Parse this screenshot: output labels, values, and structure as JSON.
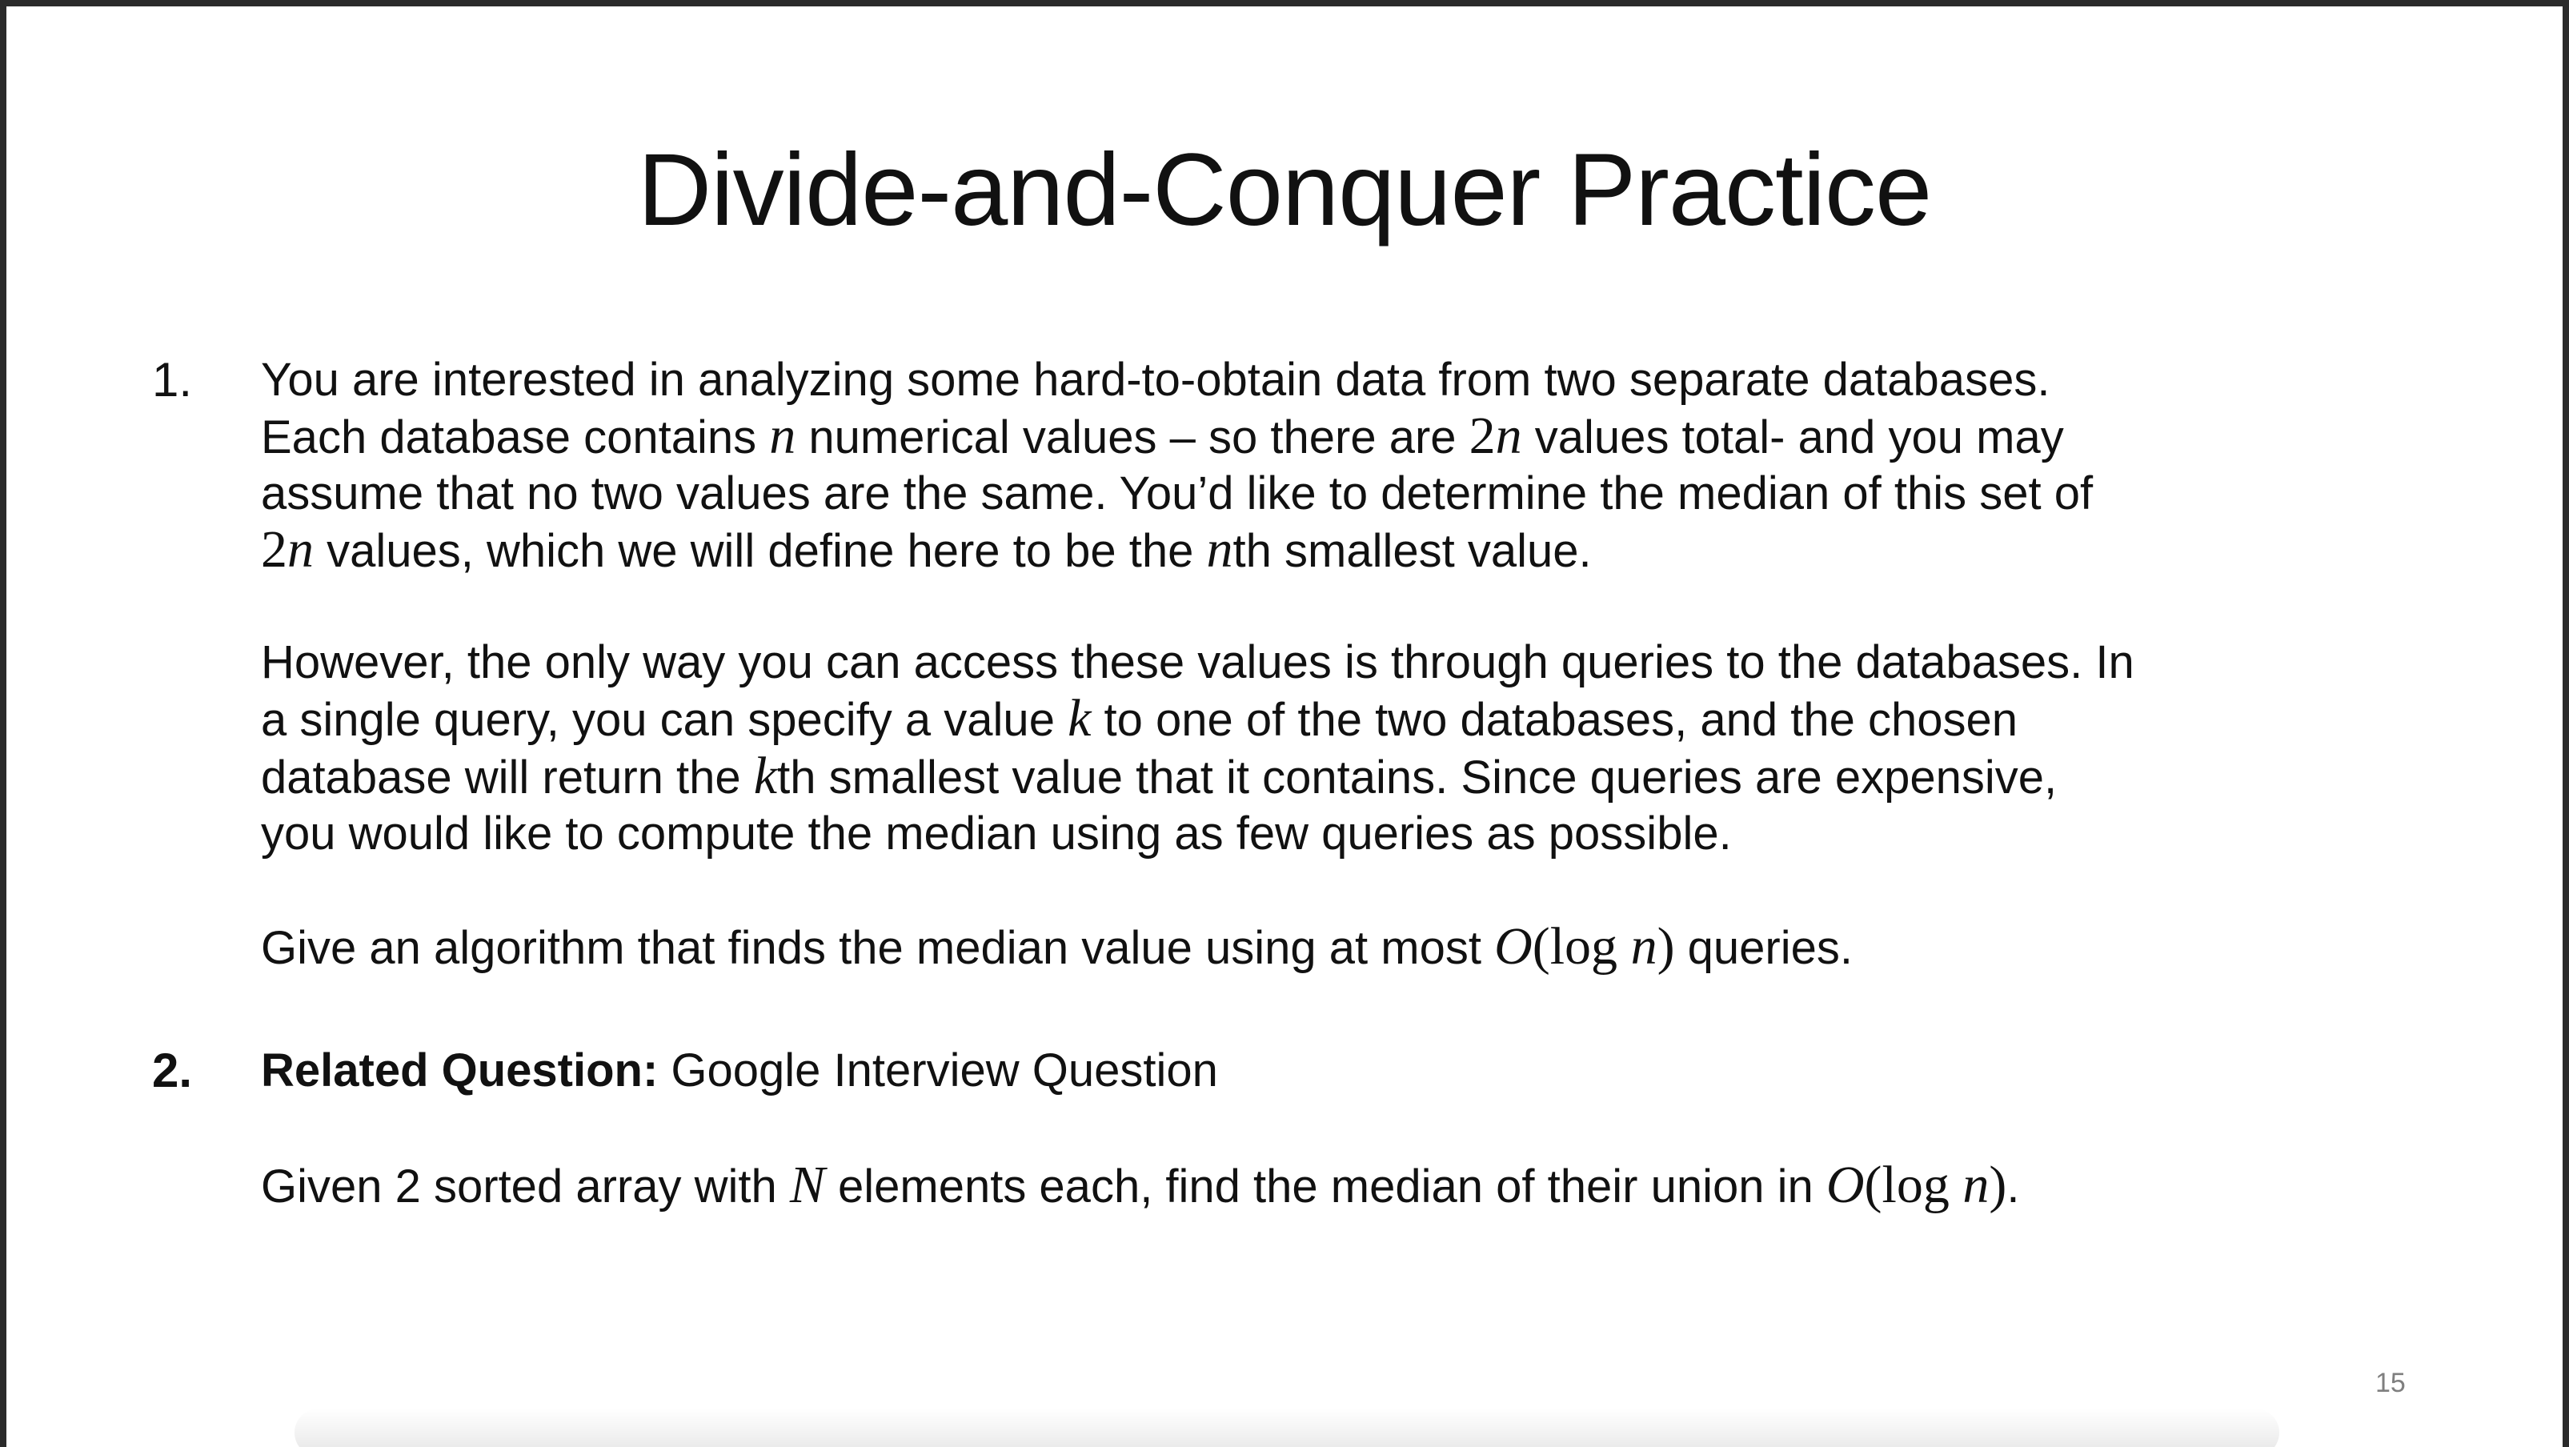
{
  "slide": {
    "title": "Divide-and-Conquer Practice",
    "page_number": "15",
    "item1": {
      "number": "1.",
      "p1": {
        "l1": "You are interested in analyzing some hard-to-obtain data from two separate databases.",
        "l2_a": "Each database contains ",
        "l2_b": " numerical values – so there are ",
        "l2_c": " values total- and you may",
        "l3": "assume that no two values are the same. You’d like to determine the median of this set of",
        "l4_b": " values, which we will define here to be the ",
        "l4_c": "th smallest value."
      },
      "p2": {
        "l1": "However, the only way you can access these values is through queries to the databases. In",
        "l2_a": "a single query, you can specify a value ",
        "l2_b": " to one of the two databases, and the chosen",
        "l3_a": "database will return the ",
        "l3_b": "th smallest value that it contains. Since queries are expensive,",
        "l4": "you would like to compute the median using as few queries as possible."
      },
      "p3": {
        "a": "Give an algorithm that finds the median value using at most ",
        "b": " queries."
      }
    },
    "item2": {
      "number": "2.",
      "label": "Related Question:",
      "heading_rest": " Google Interview Question",
      "p_a": "Given 2 sorted array with ",
      "p_b": " elements each, find the median of their union in ",
      "p_c": "."
    },
    "math": {
      "n": "n",
      "two_n": "2n",
      "two": "2",
      "k": "k",
      "N": "N",
      "O": "O",
      "open_log": "(log",
      "close": ")"
    }
  }
}
